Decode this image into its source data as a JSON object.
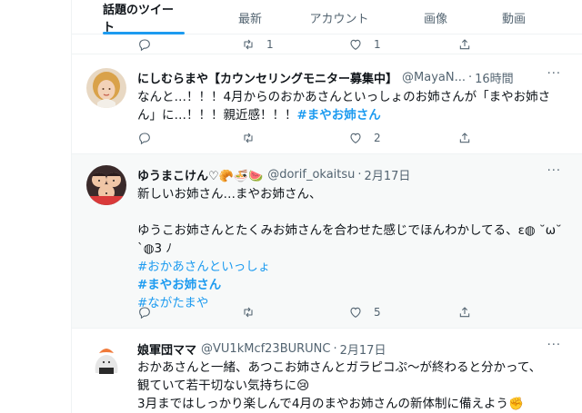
{
  "tabs": [
    {
      "label": "話題のツイート",
      "active": true
    },
    {
      "label": "最新",
      "active": false
    },
    {
      "label": "アカウント",
      "active": false
    },
    {
      "label": "画像",
      "active": false
    },
    {
      "label": "動画",
      "active": false
    }
  ],
  "top_partial": {
    "retweet_count": "1",
    "like_count": "1"
  },
  "tweets": [
    {
      "name": "にしむらまや【カウンセリングモニター募集中】",
      "handle": "@MayaN...",
      "time": "16時間",
      "lines": [
        "なんと…！！！4月からのおかあさんといっしょのお姉さんが「まやお姉さ",
        "ん」に…！！！親近感！！！"
      ],
      "inline_hashtag": "#まやお姉さん",
      "reply_count": "",
      "retweet_count": "",
      "like_count": "2"
    },
    {
      "name": "ゆうまこけん♡🥐🍜🍉",
      "handle": "@dorif_okaitsu",
      "time": "2月17日",
      "lines": [
        "新しいお姉さん…まやお姉さん、",
        "",
        "ゆうこお姉さんとたくみお姉さんを合わせた感じでほんわかしてる、ε◍ ˘ω˘",
        "`◍3 ﾉ"
      ],
      "hashtags": [
        "#おかあさんといっしょ",
        "#まやお姉さん",
        "#ながたまや"
      ],
      "like_count": "5"
    },
    {
      "name": "娘軍団ママ",
      "handle": "@VU1kMcf23BURUNC",
      "time": "2月17日",
      "lines": [
        "おかあさんと一緒、あつこお姉さんとガラピコぷ〜が終わると分かって、",
        "観ていて若干切ない気持ちに😢",
        "3月まではしっかり楽しんで4月のまやお姉さんの新体制に備えよう✊"
      ]
    }
  ],
  "more_label": "···",
  "icons": [
    "reply-icon",
    "retweet-icon",
    "like-icon",
    "share-icon",
    "more-icon"
  ],
  "colors": {
    "accent": "#1d9bf0",
    "text": "#0f1419",
    "muted": "#536471",
    "border": "#eff3f4",
    "shaded": "#f7f9f9"
  }
}
